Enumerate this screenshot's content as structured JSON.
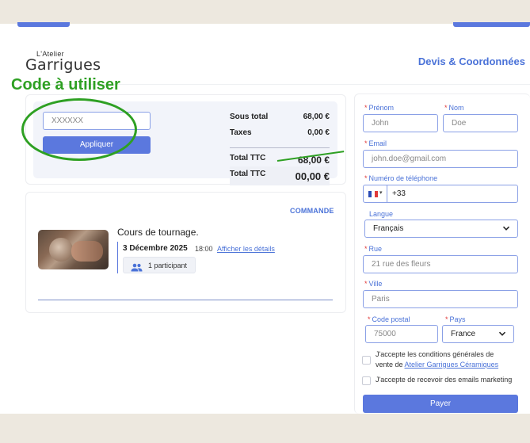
{
  "header": {
    "logo_small": "L'Atelier",
    "logo_big": "Garrigues",
    "title": "Devis & Coordonnées"
  },
  "annotation": {
    "label": "Code à utiliser",
    "color": "#2ea023"
  },
  "promo": {
    "placeholder": "XXXXXX",
    "button_label": "Appliquer"
  },
  "totals": {
    "subtotal_label": "Sous total",
    "subtotal_value": "68,00 €",
    "taxes_label": "Taxes",
    "taxes_value": "0,00 €",
    "total_label": "Total TTC",
    "total_old_value": "68,00 €",
    "total_label_2": "Total TTC",
    "total_new_value": "00,00 €"
  },
  "order": {
    "kicker": "COMMANDE",
    "product_name": "Cours de tournage.",
    "date": "3 Décembre 2025",
    "time": "18:00",
    "details_link": "Afficher les détails",
    "participants": "1 participant"
  },
  "form": {
    "first_name_label": "Prénom",
    "first_name_placeholder": "John",
    "last_name_label": "Nom",
    "last_name_placeholder": "Doe",
    "email_label": "Email",
    "email_placeholder": "john.doe@gmail.com",
    "phone_label": "Numéro de téléphone",
    "phone_prefix": "+33",
    "language_label": "Langue",
    "language_value": "Français",
    "street_label": "Rue",
    "street_placeholder": "21 rue des fleurs",
    "city_label": "Ville",
    "city_placeholder": "Paris",
    "postal_label": "Code postal",
    "postal_placeholder": "75000",
    "country_label": "Pays",
    "country_value": "France",
    "terms_text_1": "J'accepte les conditions générales de",
    "terms_text_2": "vente de ",
    "terms_link": "Atelier Garrigues Céramiques",
    "marketing_text": "J'accepte de recevoir des emails marketing",
    "pay_button": "Payer"
  },
  "colors": {
    "accent": "#5b78de",
    "link": "#4a72d8",
    "required": "#e03b3b",
    "background": "#ede8df"
  }
}
